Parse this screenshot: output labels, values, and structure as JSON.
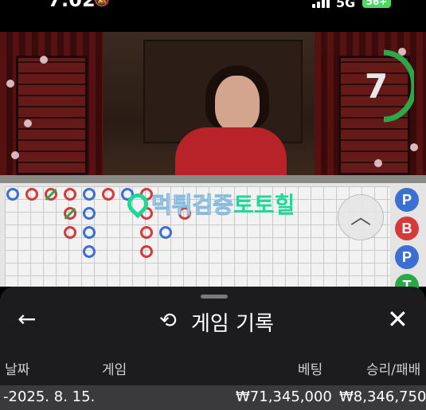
{
  "status_bar": {
    "time": "7:02",
    "network": "5G",
    "battery": "56+"
  },
  "video": {
    "timer": "7"
  },
  "watermark": {
    "part1": "먹튀검증",
    "part2": "토토힐"
  },
  "roadmap": {
    "predictions": [
      "P",
      "B",
      "P",
      "T"
    ]
  },
  "history_panel": {
    "title": "게임 기록",
    "columns": {
      "date": "날짜",
      "game": "게임",
      "bet": "베팅",
      "result": "승리/패배"
    },
    "rows": [
      {
        "date": "-2025. 8. 15.",
        "game": "",
        "bet": "₩71,345,000",
        "result": "₩8,346,750"
      }
    ]
  },
  "colors": {
    "player": "#3b6fd1",
    "banker": "#d33a3a",
    "tie": "#2ca84a",
    "watermark_accent": "#1ed89a"
  }
}
